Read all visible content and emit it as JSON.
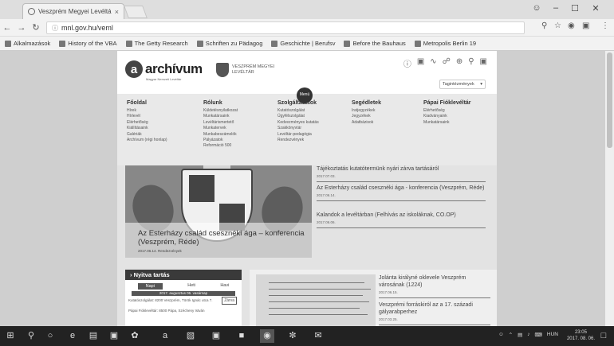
{
  "browser": {
    "tab_title": "Veszprém Megyei Levéltár",
    "tab_close": "×",
    "url": "mnl.gov.hu/veml",
    "window_controls": [
      "–",
      "☐",
      "✕"
    ],
    "bookmarks": [
      "Alkalmazások",
      "History of the VBA",
      "The Getty Research",
      "Schriften zu Pädagog",
      "Geschichte | Berufsv",
      "Before the Bauhaus",
      "Metropolis Berlin 19"
    ]
  },
  "header": {
    "logo_word": "archívum",
    "logo_sub": "Magyar Nemzeti Levéltár",
    "logo2": "VESZPRÉM MEGYEI LEVÉLTÁR",
    "menu_button": "Menü",
    "lang_select": "Tagintézmények"
  },
  "menu": {
    "columns": [
      {
        "title": "Főoldal",
        "items": [
          "Hírek",
          "Hírlevél",
          "Elérhetőség",
          "Kiállításaink",
          "Galériák",
          "Archívum (régi honlap)"
        ]
      },
      {
        "title": "Rólunk",
        "items": [
          "Küldetésnyilatkozat",
          "Munkatársaink",
          "Levéltárismertető",
          "Munkatervek",
          "Munkabeszámolók",
          "Pályázatok",
          "Reformáció 500"
        ]
      },
      {
        "title": "Szolgáltatások",
        "items": [
          "Kutatószolgálat",
          "Ügyfélszolgálat",
          "Kedvezményes kutatás",
          "Szakkönyvtár",
          "Levéltár-pedagógia",
          "Rendezvények"
        ]
      },
      {
        "title": "Segédletek",
        "items": [
          "Iratjegyzékek",
          "Jegyzékek",
          "Adatbázisok"
        ]
      },
      {
        "title": "Pápai Fióklevéltár",
        "items": [
          "Elérhetőség",
          "Kiadványaink",
          "Munkatársaink"
        ]
      }
    ]
  },
  "hero": {
    "title": "Az Esterházy család csesznéki ága – konferencia (Veszprém, Réde)",
    "date": "2017.06.14. Rendezvények"
  },
  "news": [
    {
      "title": "Tájékoztatás kutatótermünk nyári zárva tartásáról",
      "date": "2017.07.03."
    },
    {
      "title": "Az Esterházy család csesznéki ága - konferencia (Veszprém, Réde)",
      "date": "2017.06.14."
    },
    {
      "title": "Kalandok a levéltárban (Felhívás az iskoláknak, CO.OP)",
      "date": "2017.06.06."
    }
  ],
  "hours": {
    "title": "Nyitva tartás",
    "tabs": [
      "Napi",
      "Heti",
      "Havi"
    ],
    "date": "2017. augusztus 06. vasárnap",
    "rows": [
      {
        "text": "Kutatószolgálat: 8200 Veszprém, Török Ignác utca 7.",
        "status": "Zárva"
      },
      {
        "text": "Pápai Fióklevéltár: 8500 Pápa, Szécheny István",
        "status": ""
      }
    ]
  },
  "doc_news": [
    {
      "title": "Jolánta királyné oklevele Veszprém városának (1224)",
      "date": "2017.06.15."
    },
    {
      "title": "Veszprémi forráskiról az a 17. századi gályarabperhez",
      "date": "2017.03.25."
    }
  ],
  "taskbar": {
    "lang": "HUN",
    "time": "23:05",
    "date": "2017. 08. 06."
  }
}
